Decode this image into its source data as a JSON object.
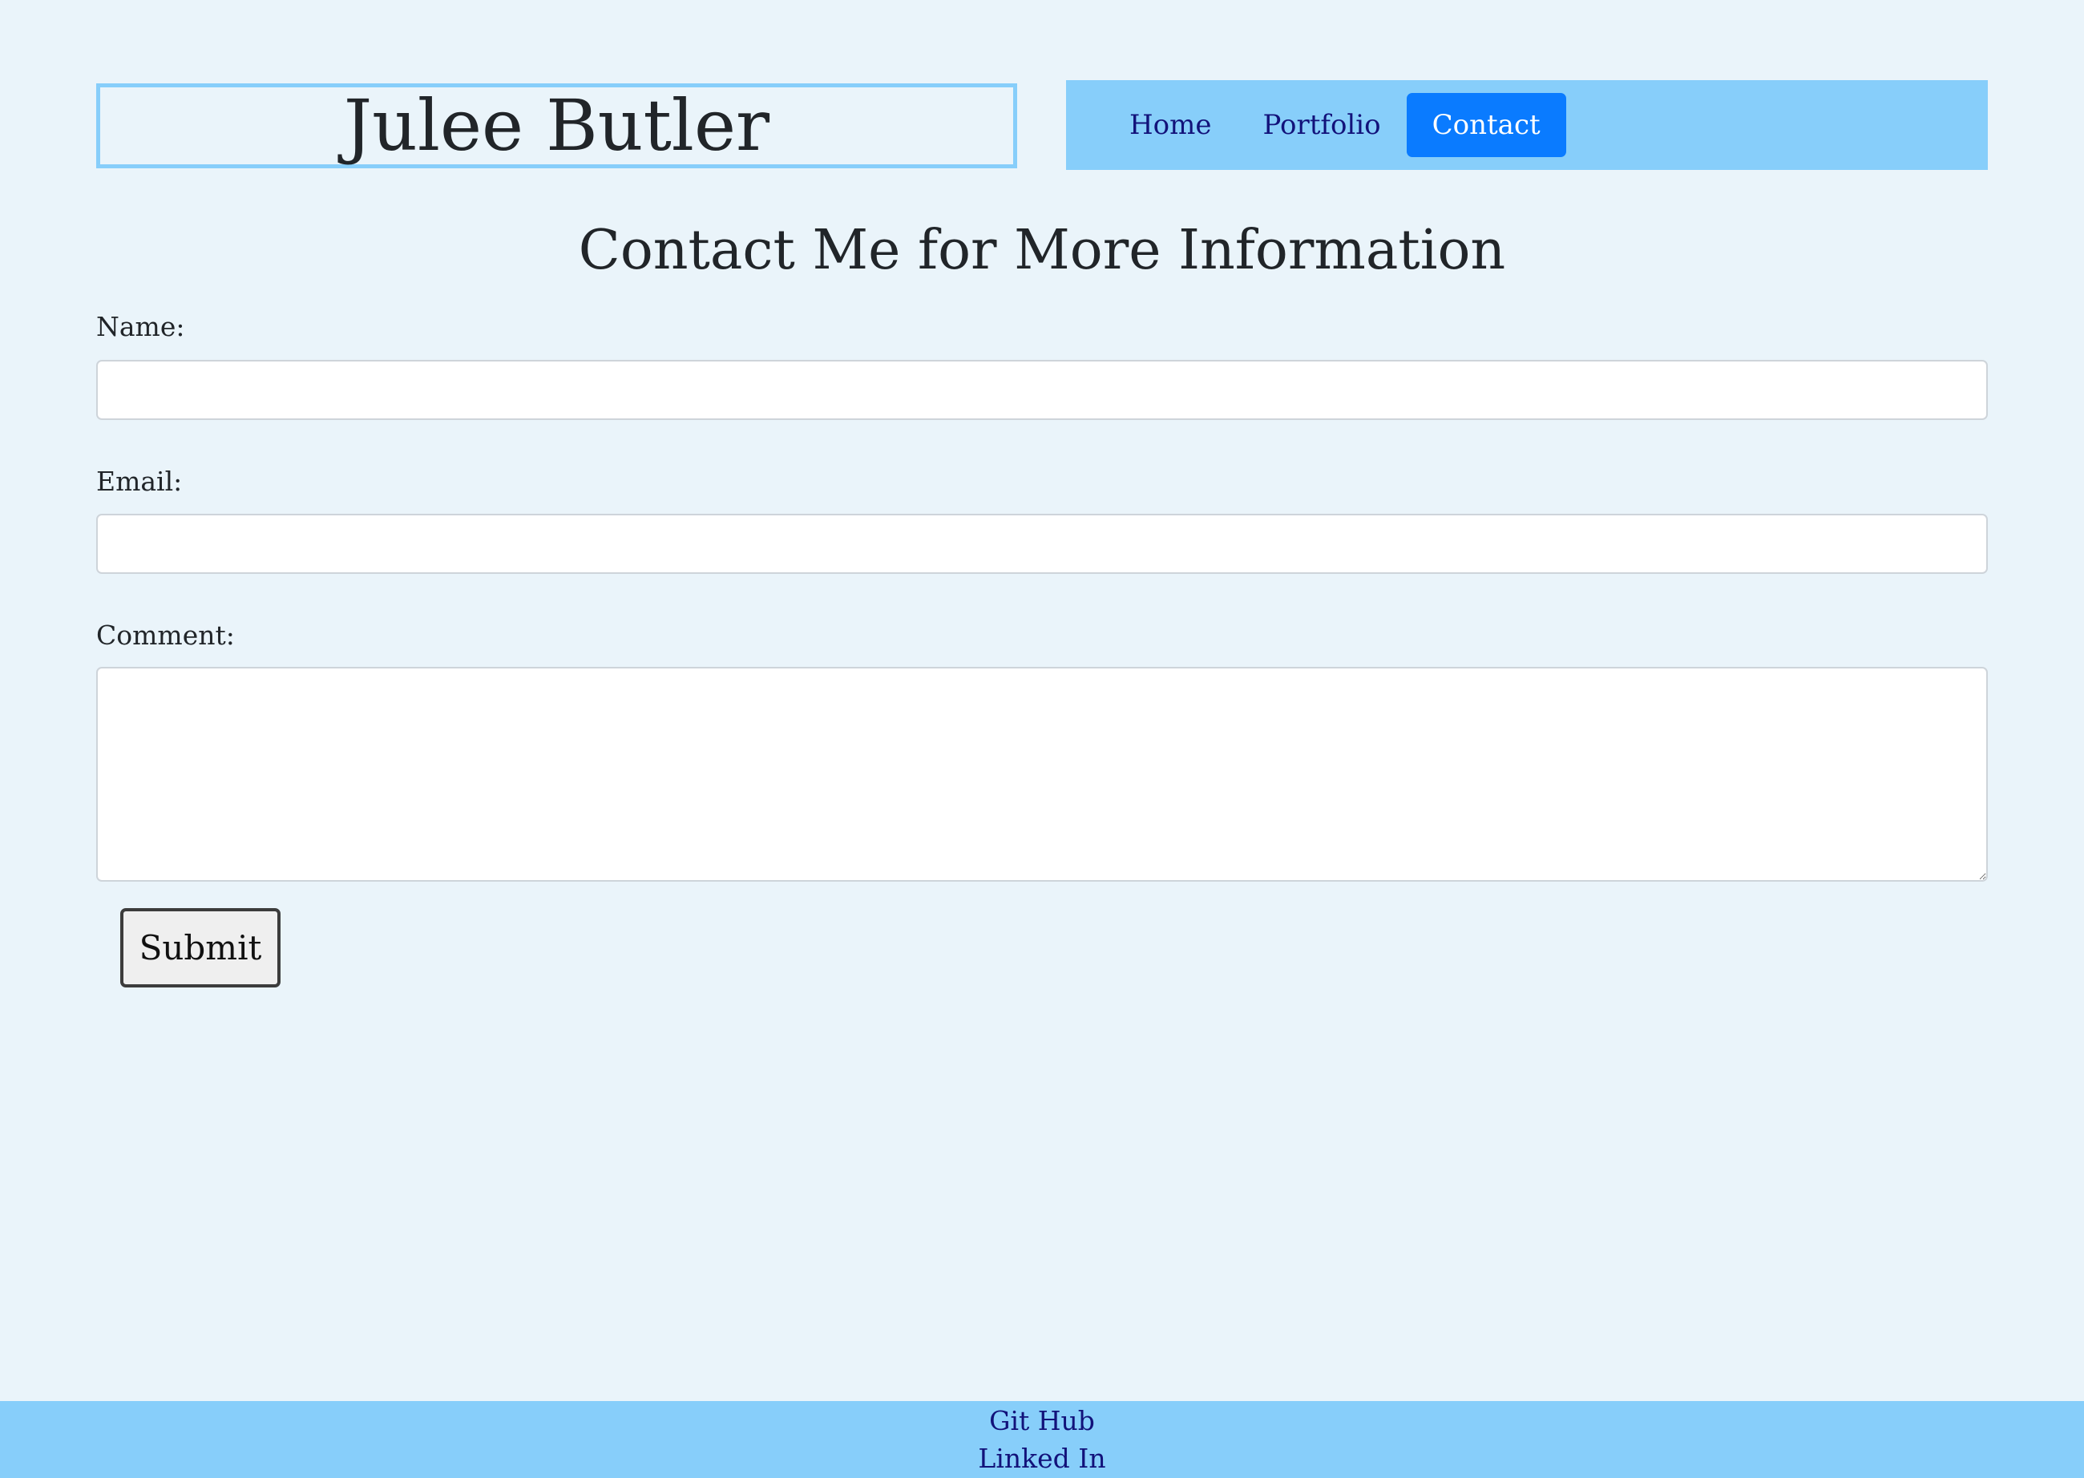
{
  "header": {
    "site_title": "Julee Butler"
  },
  "nav": {
    "items": [
      {
        "label": "Home",
        "active": false
      },
      {
        "label": "Portfolio",
        "active": false
      },
      {
        "label": "Contact",
        "active": true
      }
    ]
  },
  "main": {
    "heading": "Contact Me for More Information",
    "form": {
      "name_label": "Name:",
      "name_value": "",
      "email_label": "Email:",
      "email_value": "",
      "comment_label": "Comment:",
      "comment_value": "",
      "submit_label": "Submit"
    }
  },
  "footer": {
    "links": [
      "Git Hub",
      "Linked In"
    ]
  },
  "colors": {
    "page_background": "#eaf4fa",
    "accent_light_blue": "#87cefa",
    "active_nav_blue": "#0a7bff",
    "link_navy": "#12127a",
    "text_dark": "#212529"
  }
}
